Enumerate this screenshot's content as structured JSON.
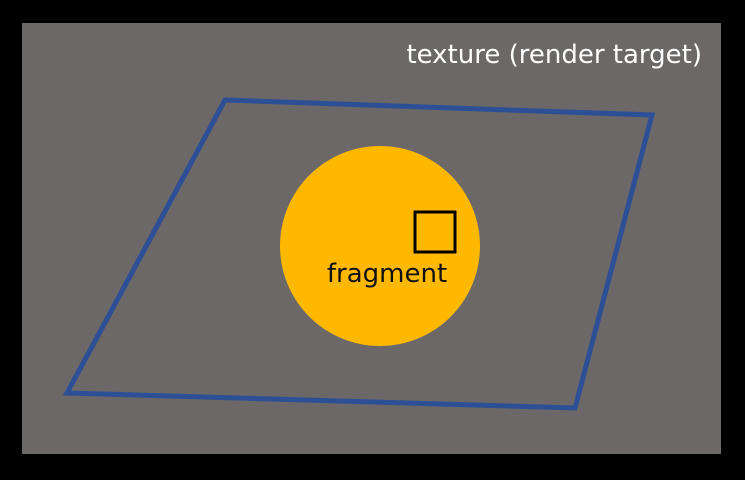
{
  "labels": {
    "texture": "texture (render target)",
    "fragment": "fragment"
  },
  "colors": {
    "background": "#000000",
    "texture_fill": "#6b6867",
    "quad_stroke": "#2d4f96",
    "circle_fill": "#ffb800",
    "pixel_stroke": "#000000",
    "texture_label": "#ffffff",
    "fragment_label": "#111111"
  }
}
